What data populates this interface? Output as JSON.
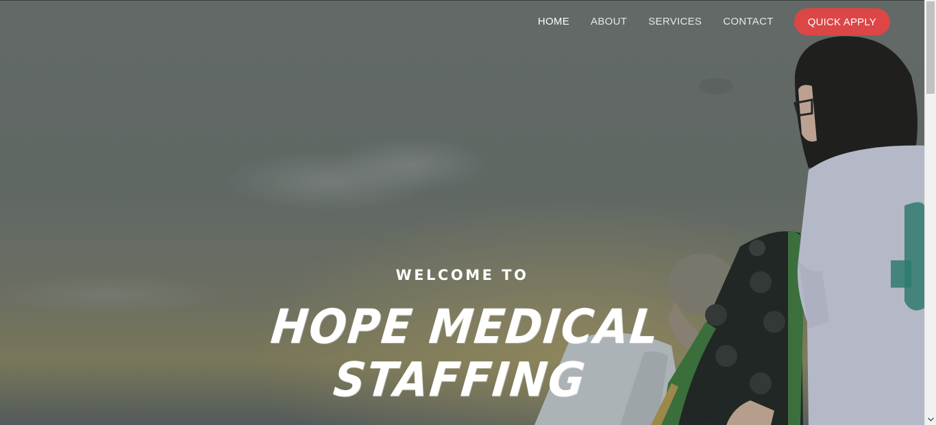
{
  "nav": {
    "items": [
      {
        "label": "HOME",
        "active": true
      },
      {
        "label": "ABOUT",
        "active": false
      },
      {
        "label": "SERVICES",
        "active": false
      },
      {
        "label": "CONTACT",
        "active": false
      }
    ],
    "cta_label": "QUICK APPLY"
  },
  "hero": {
    "welcome": "WELCOME TO",
    "brand_line1": "HOPE MEDICAL",
    "brand_line2": "STAFFING"
  },
  "colors": {
    "cta_background": "#dc4646",
    "text": "#ffffff",
    "overlay": "#6f7674"
  },
  "scrollbar": {
    "down_arrow_icon": "chevron-down-icon"
  }
}
